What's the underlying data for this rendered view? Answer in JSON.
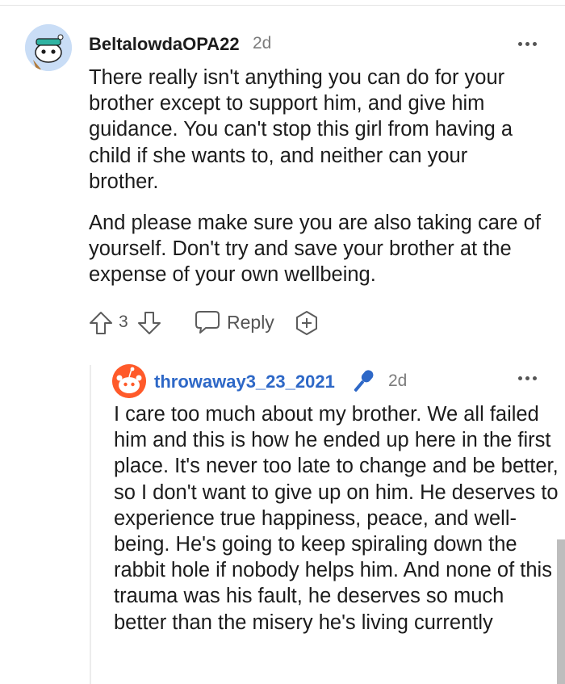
{
  "comment": {
    "author": "BeltalowdaOPA22",
    "age": "2d",
    "paragraphs": [
      "There really isn't anything you can do for your brother except to support him, and give him guidance. You can't stop this girl from having a child if she wants to, and neither can your brother.",
      "And please make sure you are also taking care of yourself. Don't try and save your brother at the expense of your own wellbeing."
    ],
    "vote_count": "3",
    "reply_label": "Reply"
  },
  "reply": {
    "author": "throwaway3_23_2021",
    "age": "2d",
    "text": "I care too much about my brother. We all failed him and this is how he ended up here in the first place. It's never too late to change and be better, so I don't want to give up on him. He deserves to experience true happiness, peace, and well-being. He's going to keep spiraling down the rabbit hole if nobody helps him. And none of this trauma was his fault, he deserves so much better than the misery he's living currently",
    "author_color": "#2e68c7",
    "badge_icon": "microphone-icon"
  },
  "icons": {
    "avatar_1": "snoo-avatar-icon",
    "avatar_2": "snoo-avatar-icon",
    "more": "more-options-icon",
    "upvote": "upvote-arrow-icon",
    "downvote": "downvote-arrow-icon",
    "reply": "speech-bubble-icon",
    "award": "award-plus-icon"
  }
}
